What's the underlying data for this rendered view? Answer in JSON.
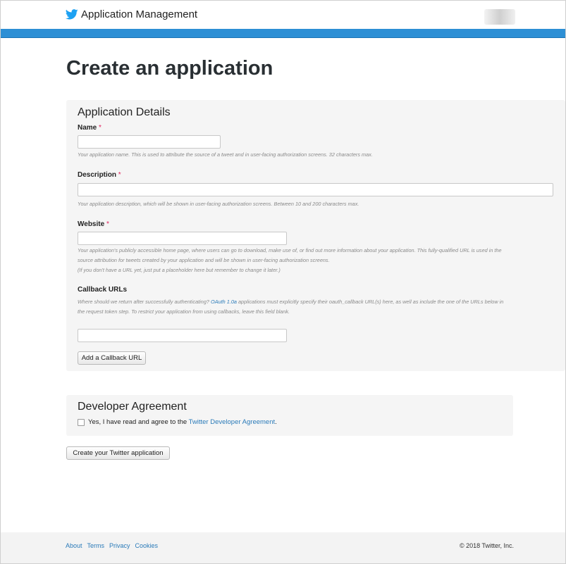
{
  "header": {
    "app_title": "Application Management",
    "icons": {
      "logo": "twitter-bird-icon"
    },
    "colors": {
      "accent_bar": "#2d8fd5",
      "bird": "#1da1f2"
    }
  },
  "page": {
    "title": "Create an application"
  },
  "details": {
    "title": "Application Details",
    "required_marker": "*",
    "name": {
      "label": "Name",
      "value": "",
      "help": "Your application name. This is used to attribute the source of a tweet and in user-facing authorization screens. 32 characters max."
    },
    "description": {
      "label": "Description",
      "value": "",
      "help": "Your application description, which will be shown in user-facing authorization screens. Between 10 and 200 characters max."
    },
    "website": {
      "label": "Website",
      "value": "",
      "help_line1": "Your application's publicly accessible home page, where users can go to download, make use of, or find out more information about your application. This fully-qualified URL is used in the",
      "help_line2": "source attribution for tweets created by your application and will be shown in user-facing authorization screens.",
      "help_line3": "(If you don't have a URL yet, just put a placeholder here but remember to change it later.)"
    },
    "callback": {
      "label": "Callback URLs",
      "help_part1": "Where should we return after successfully authenticating? ",
      "help_link": "OAuth 1.0a",
      "help_part2": " applications must explicitly specify their oauth_callback URL(s) here, as well as include the one of the URLs below in",
      "help_line2": "the request token step. To restrict your application from using callbacks, leave this field blank.",
      "value": "",
      "add_button": "Add a Callback URL"
    }
  },
  "agreement": {
    "title": "Developer Agreement",
    "checked": false,
    "text": "Yes, I have read and agree to the ",
    "link": "Twitter Developer Agreement",
    "suffix": "."
  },
  "submit_button": "Create your Twitter application",
  "footer": {
    "links": [
      "About",
      "Terms",
      "Privacy",
      "Cookies"
    ],
    "copyright": "© 2018 Twitter, Inc."
  }
}
